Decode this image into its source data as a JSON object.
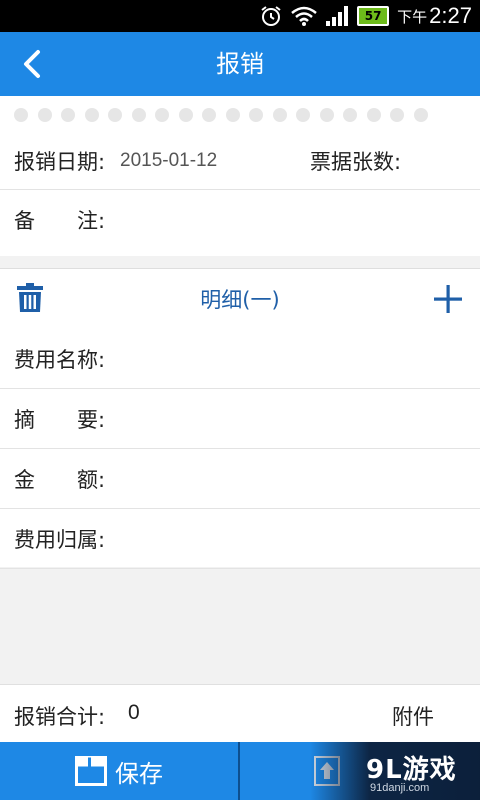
{
  "status_bar": {
    "time": "2:27",
    "ampm": "下午",
    "battery": "57"
  },
  "app_bar": {
    "title": "报销"
  },
  "header_form": {
    "date_label": "报销日期:",
    "date_value": "2015-01-12",
    "count_label": "票据张数:",
    "note_label": "备　　注:"
  },
  "detail": {
    "title": "明细(一)",
    "fields": [
      {
        "label": "费用名称:"
      },
      {
        "label": "摘　　要:"
      },
      {
        "label": "金　　额:"
      },
      {
        "label": "费用归属:"
      }
    ]
  },
  "summary": {
    "total_label": "报销合计:",
    "total_value": "0",
    "attachment_label": "附件"
  },
  "bottom_bar": {
    "save_label": "保存"
  },
  "watermark": {
    "logo": "9L游戏",
    "url": "91danji.com"
  },
  "colors": {
    "primary": "#1e88e5",
    "detail_accent": "#1f5fa8"
  },
  "icons": [
    "alarm-icon",
    "wifi-icon",
    "signal-icon",
    "battery-icon",
    "back-arrow-icon",
    "trash-icon",
    "plus-icon",
    "save-icon",
    "upload-icon"
  ]
}
